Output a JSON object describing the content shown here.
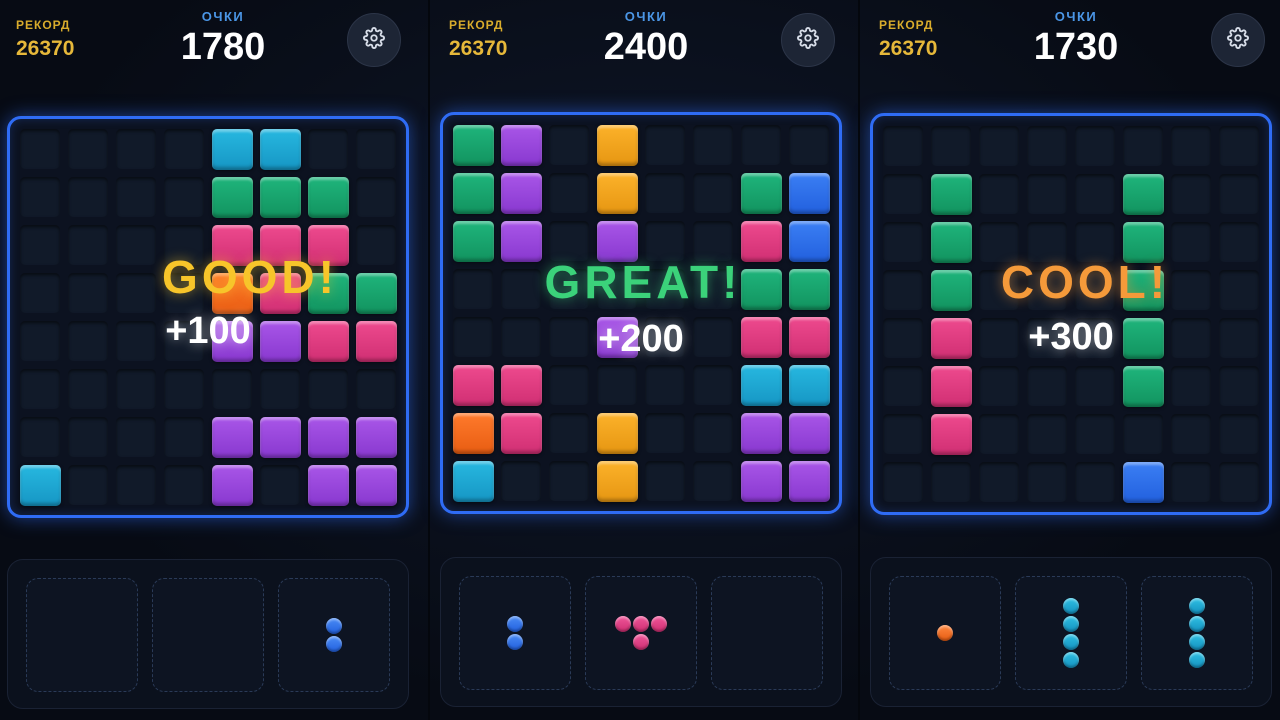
{
  "colors": {
    "cyan": "#1fa8d6",
    "green": "#17a56e",
    "pink": "#e03c80",
    "purple": "#9a47dc",
    "orange": "#f26c1f",
    "yellow": "#f4a41e",
    "blue": "#2e70ea",
    "board_border": "#2f6cf5",
    "record": "#e6b83a",
    "score_label": "#4b96e6"
  },
  "panels": [
    {
      "record_label": "РЕКОРД",
      "record_value": "26370",
      "score_label": "ОЧКИ",
      "score_value": "1780",
      "settings_icon": "gear-icon",
      "combo_text": "GOOD!",
      "points_text": "+100",
      "board": [
        "....cc..",
        "....ggg.",
        "....ppp.",
        "....opgg",
        "....vvpp",
        "........",
        "....vvvv",
        "c...v.vv"
      ],
      "tray": [
        {
          "empty": true
        },
        {
          "empty": true
        },
        {
          "color": "blue",
          "shape": [
            "x",
            "x"
          ]
        }
      ]
    },
    {
      "record_label": "РЕКОРД",
      "record_value": "26370",
      "score_label": "ОЧКИ",
      "score_value": "2400",
      "settings_icon": "gear-icon",
      "combo_text": "GREAT!",
      "points_text": "+200",
      "board": [
        "gv.y....",
        "gv.y..gb",
        "gv.v..pb",
        "......gg",
        "...v..pp",
        "pp....cc",
        "op.y..vv",
        "c..y..vv"
      ],
      "tray": [
        {
          "color": "blue",
          "shape": [
            "x",
            "x"
          ]
        },
        {
          "color": "pink",
          "shape": [
            "xxx",
            ".x."
          ]
        },
        {
          "empty": true
        }
      ]
    },
    {
      "record_label": "РЕКОРД",
      "record_value": "26370",
      "score_label": "ОЧКИ",
      "score_value": "1730",
      "settings_icon": "gear-icon",
      "combo_text": "COOL!",
      "points_text": "+300",
      "board": [
        "........",
        ".g...g..",
        ".g...g..",
        ".g...g..",
        ".p...g..",
        ".p...g..",
        ".p......",
        ".....b.."
      ],
      "tray": [
        {
          "color": "orange",
          "shape": [
            "x"
          ]
        },
        {
          "color": "cyan",
          "shape": [
            "x",
            "x",
            "x",
            "x"
          ]
        },
        {
          "color": "cyan",
          "shape": [
            "x",
            "x",
            "x",
            "x"
          ]
        }
      ]
    }
  ]
}
